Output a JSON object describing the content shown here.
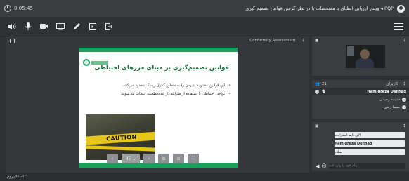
{
  "header": {
    "time": "0:05:45",
    "title": "PQP ◂ وبینار ارزیابی انطباق با مشخصات با در نظر گرفتن قوانین تصمیم گیری"
  },
  "toolbar": {
    "buttons": [
      "speaker-icon",
      "microphone-icon",
      "camera-icon",
      "screen-share-icon",
      "pen-icon",
      "slides-icon",
      "exit-icon"
    ]
  },
  "presentation": {
    "header_label": "Conformity Assessment",
    "slide": {
      "title": "قوانین تصمیم‌گیری بر مبنای مرزهای احتیاطی",
      "bullets": [
        "این قوانین محدوده پذیرش را به منظور کنترل ریسک محدود می‌کنند.",
        "نواحی احتیاطی با استفاده از ضرایبی از عدم‌قطعیت انتخاب می‌شوند."
      ],
      "photo_text": "CAUTION"
    },
    "controls": {
      "prev": "‹",
      "page": "45 ⌄",
      "next": "›",
      "zoom_in": "⊕",
      "zoom_out": "⊖",
      "fit": "⛶"
    }
  },
  "sidebar": {
    "participants_count": "21",
    "participants_label": "کاربران",
    "users": [
      {
        "name": "Hamidreza Dehnad"
      },
      {
        "name": "سپیده رحیمی"
      },
      {
        "name": "سیما زندی"
      }
    ],
    "chat": {
      "messages": [
        "الان تایم استراحته",
        "Hamidreza Dehnad",
        "سلام"
      ],
      "placeholder": "پیام خود را وارد کنید"
    }
  },
  "footer": {
    "brand": "اسکای‌روم™"
  }
}
